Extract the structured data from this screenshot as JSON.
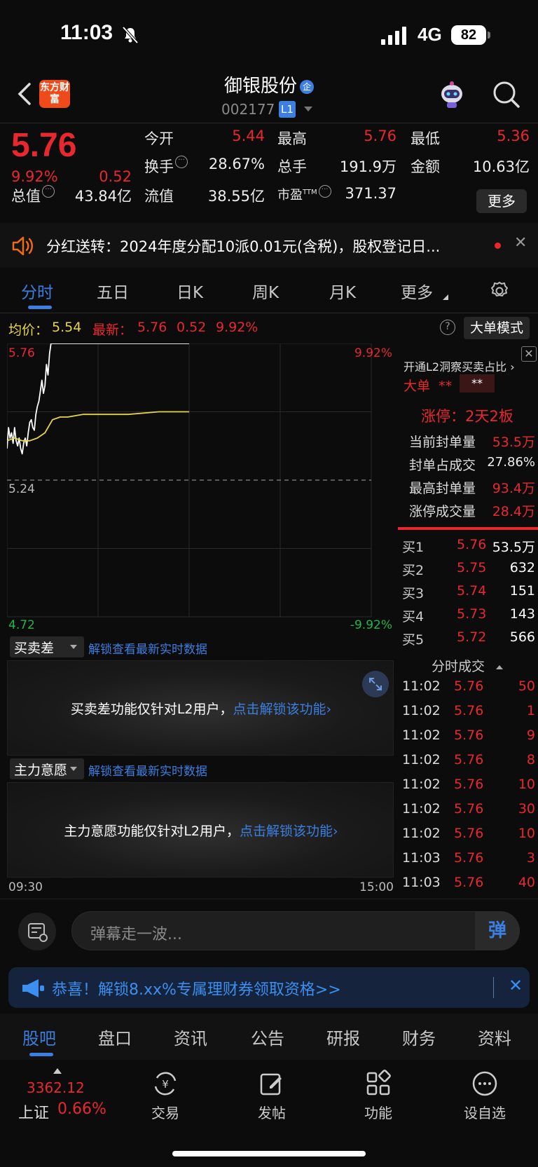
{
  "status_bar": {
    "time": "11:03",
    "network": "4G",
    "battery": "82"
  },
  "header": {
    "stock_name": "御银股份",
    "qiye_badge": "企",
    "stock_code": "002177",
    "level_badge": "L1",
    "brand_logo_text": "东方财富"
  },
  "quote": {
    "price": "5.76",
    "change_pct": "9.92%",
    "change": "0.52",
    "items": [
      {
        "label": "今开",
        "value": "5.44"
      },
      {
        "label": "最高",
        "value": "5.76"
      },
      {
        "label": "最低",
        "value": "5.36"
      },
      {
        "label": "换手",
        "value": "28.67%"
      },
      {
        "label": "总手",
        "value": "191.9万"
      },
      {
        "label": "金额",
        "value": "10.63亿"
      },
      {
        "label": "总值",
        "value": "43.84亿"
      },
      {
        "label": "流值",
        "value": "38.55亿"
      },
      {
        "label": "市盈",
        "sup": "TTM",
        "value": "371.37"
      }
    ],
    "more_button": "更多"
  },
  "notice": {
    "text": "分红送转：2024年度分配10派0.01元(含税)，股权登记日..."
  },
  "chart_tabs": [
    "分时",
    "五日",
    "日K",
    "周K",
    "月K",
    "更多"
  ],
  "info_bar": {
    "avg_label": "均价：",
    "avg_value": "5.54",
    "latest_label": "最新：",
    "latest_value": "5.76",
    "latest_change": "0.52",
    "latest_pct": "9.92%",
    "help": "?",
    "mode_button": "大单模式"
  },
  "chart_data": {
    "type": "line",
    "y_axis_left": [
      "5.76",
      "5.24",
      "4.72"
    ],
    "y_axis_right": [
      "9.92%",
      "-9.92%"
    ],
    "ylim": [
      4.72,
      5.76
    ],
    "prev_close": 5.24,
    "x_axis": [
      "09:30",
      "15:00"
    ],
    "series": [
      {
        "role": "price",
        "color": "#ffffff",
        "x": [
          0,
          1,
          2,
          3,
          4,
          5,
          6,
          7,
          8,
          9,
          10,
          11,
          12,
          13,
          14,
          15,
          16,
          17,
          18,
          19,
          20,
          21,
          22,
          23,
          24,
          25,
          26,
          27,
          28,
          29,
          30,
          31,
          32,
          33,
          34,
          35,
          36,
          37,
          38,
          39,
          40,
          41,
          42,
          43,
          44,
          45,
          50,
          60,
          80,
          100,
          120
        ],
        "values": [
          5.36,
          5.44,
          5.4,
          5.42,
          5.38,
          5.44,
          5.39,
          5.37,
          5.4,
          5.36,
          5.34,
          5.38,
          5.4,
          5.37,
          5.42,
          5.46,
          5.47,
          5.44,
          5.43,
          5.49,
          5.52,
          5.54,
          5.58,
          5.62,
          5.57,
          5.6,
          5.68,
          5.64,
          5.72,
          5.76,
          5.76,
          5.76,
          5.76,
          5.76,
          5.76,
          5.76,
          5.76,
          5.76,
          5.76,
          5.76,
          5.76,
          5.76,
          5.76,
          5.76,
          5.76,
          5.76,
          5.76,
          5.76,
          5.76,
          5.76,
          5.76
        ]
      },
      {
        "role": "average",
        "color": "#e7d44a",
        "x": [
          0,
          5,
          10,
          15,
          20,
          25,
          28,
          30,
          35,
          40,
          50,
          60,
          80,
          100,
          120
        ],
        "values": [
          5.39,
          5.4,
          5.39,
          5.39,
          5.4,
          5.42,
          5.45,
          5.47,
          5.48,
          5.48,
          5.49,
          5.49,
          5.49,
          5.5,
          5.5
        ]
      }
    ]
  },
  "l2_panel": {
    "open_link": "开通L2洞察买卖占比",
    "big_label": "大单",
    "big_val1": "**",
    "big_val2": "**",
    "limit_title": "涨停：2天2板",
    "rows": [
      {
        "label": "当前封单量",
        "value": "53.5万"
      },
      {
        "label": "封单占成交",
        "value": "27.86%"
      },
      {
        "label": "最高封单量",
        "value": "93.4万"
      },
      {
        "label": "涨停成交量",
        "value": "28.4万"
      }
    ]
  },
  "order_book": [
    {
      "side": "买1",
      "price": "5.76",
      "vol": "53.5万"
    },
    {
      "side": "买2",
      "price": "5.75",
      "vol": "632"
    },
    {
      "side": "买3",
      "price": "5.74",
      "vol": "151"
    },
    {
      "side": "买4",
      "price": "5.73",
      "vol": "143"
    },
    {
      "side": "买5",
      "price": "5.72",
      "vol": "566"
    }
  ],
  "ticks_title": "分时成交",
  "ticks": [
    {
      "time": "11:02",
      "price": "5.76",
      "vol": "50"
    },
    {
      "time": "11:02",
      "price": "5.76",
      "vol": "1"
    },
    {
      "time": "11:02",
      "price": "5.76",
      "vol": "9"
    },
    {
      "time": "11:02",
      "price": "5.76",
      "vol": "8"
    },
    {
      "time": "11:02",
      "price": "5.76",
      "vol": "10"
    },
    {
      "time": "11:02",
      "price": "5.76",
      "vol": "30"
    },
    {
      "time": "11:02",
      "price": "5.76",
      "vol": "10"
    },
    {
      "time": "11:03",
      "price": "5.76",
      "vol": "3"
    },
    {
      "time": "11:03",
      "price": "5.76",
      "vol": "40"
    }
  ],
  "panels": [
    {
      "select": "买卖差",
      "link": "解锁查看最新实时数据",
      "msg": "买卖差功能仅针对L2用户，",
      "msg_link": "点击解锁该功能"
    },
    {
      "select": "主力意愿",
      "link": "解锁查看最新实时数据",
      "msg": "主力意愿功能仅针对L2用户，",
      "msg_link": "点击解锁该功能"
    }
  ],
  "danmu": {
    "placeholder": "弹幕走一波...",
    "button": "弹"
  },
  "promo": {
    "text": "恭喜！解锁8.xx%专属理财券领取资格>>"
  },
  "bottom_tabs": [
    "股吧",
    "盘口",
    "资讯",
    "公告",
    "研报",
    "财务",
    "资料"
  ],
  "dock": {
    "index_value": "3362.12",
    "index_name": "上证",
    "index_pct": "0.66%",
    "items": [
      {
        "label": "交易",
        "icon": "trade-icon"
      },
      {
        "label": "发帖",
        "icon": "post-icon"
      },
      {
        "label": "功能",
        "icon": "function-icon"
      },
      {
        "label": "设自选",
        "icon": "add-watchlist-icon"
      }
    ]
  }
}
